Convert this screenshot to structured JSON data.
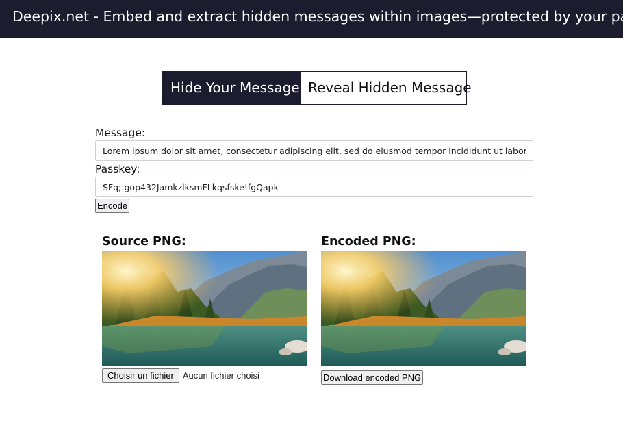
{
  "header": {
    "title": "Deepix.net - Embed and extract hidden messages within images—protected by your password."
  },
  "tabs": [
    {
      "label": "Hide Your Message",
      "active": true
    },
    {
      "label": "Reveal Hidden Message",
      "active": false
    }
  ],
  "form": {
    "message_label": "Message:",
    "message_value": "Lorem ipsum dolor sit amet, consectetur adipiscing elit, sed do eiusmod tempor incididunt ut labore et dolore magna aliqua.",
    "passkey_label": "Passkey:",
    "passkey_value": "SFq;:gop432JamkzlksmFLkqsfske!fgQapk",
    "encode_label": "Encode"
  },
  "source": {
    "title": "Source PNG:",
    "choose_label": "Choisir un fichier",
    "file_status": "Aucun fichier choisi"
  },
  "encoded": {
    "title": "Encoded PNG:",
    "download_label": "Download encoded PNG"
  },
  "colors": {
    "header_bg": "#1b1d2f",
    "active_tab_bg": "#1b1d2f"
  }
}
